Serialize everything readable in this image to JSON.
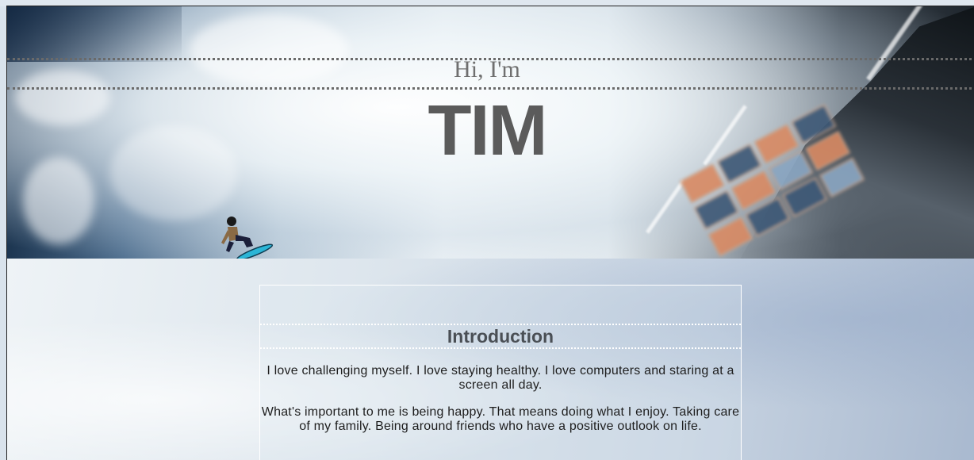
{
  "hero": {
    "greeting": "Hi, I'm",
    "name": "TIM"
  },
  "intro": {
    "heading": "Introduction",
    "paragraphs": [
      "I love challenging myself. I love staying healthy. I love computers and staring at a screen all day.",
      "What's important to me is being happy. That means doing what I enjoy. Taking care of my family. Being around friends who have a positive outlook on life."
    ]
  },
  "colors": {
    "greeting_text": "#6f6f6f",
    "name_text": "#5b5b5b",
    "heading_text": "#4a4f55",
    "body_text": "#1e1e1e"
  }
}
